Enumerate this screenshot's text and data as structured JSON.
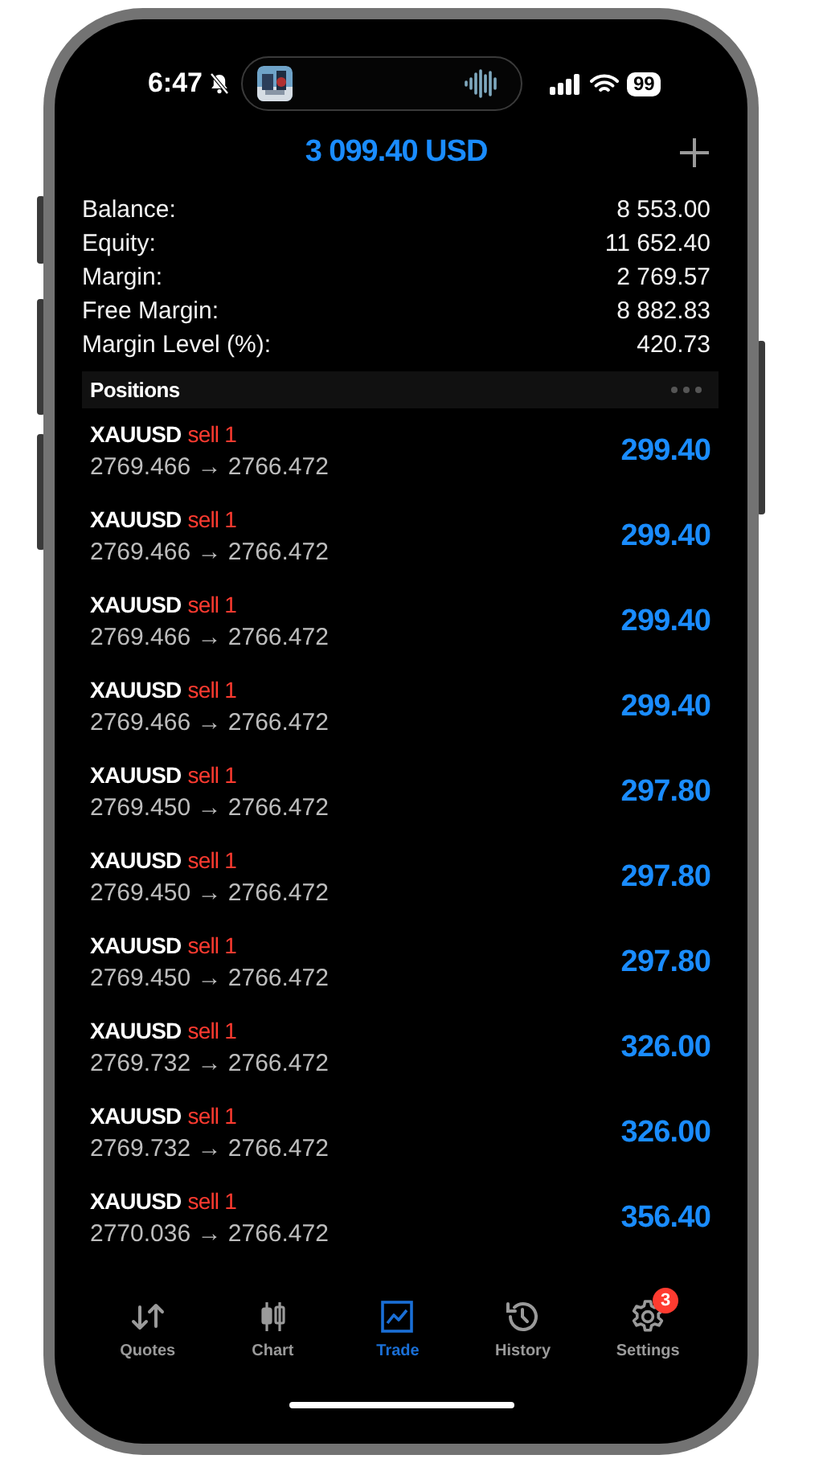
{
  "status_bar": {
    "time": "6:47",
    "battery": "99"
  },
  "header": {
    "title": "3 099.40 USD"
  },
  "summary": [
    {
      "label": "Balance:",
      "value": "8 553.00"
    },
    {
      "label": "Equity:",
      "value": "11 652.40"
    },
    {
      "label": "Margin:",
      "value": "2 769.57"
    },
    {
      "label": "Free Margin:",
      "value": "8 882.83"
    },
    {
      "label": "Margin Level (%):",
      "value": "420.73"
    }
  ],
  "positions": {
    "title": "Positions",
    "rows": [
      {
        "symbol": "XAUUSD",
        "side": "sell 1",
        "prices": "2769.466 → 2766.472",
        "profit": "299.40"
      },
      {
        "symbol": "XAUUSD",
        "side": "sell 1",
        "prices": "2769.466 → 2766.472",
        "profit": "299.40"
      },
      {
        "symbol": "XAUUSD",
        "side": "sell 1",
        "prices": "2769.466 → 2766.472",
        "profit": "299.40"
      },
      {
        "symbol": "XAUUSD",
        "side": "sell 1",
        "prices": "2769.466 → 2766.472",
        "profit": "299.40"
      },
      {
        "symbol": "XAUUSD",
        "side": "sell 1",
        "prices": "2769.450 → 2766.472",
        "profit": "297.80"
      },
      {
        "symbol": "XAUUSD",
        "side": "sell 1",
        "prices": "2769.450 → 2766.472",
        "profit": "297.80"
      },
      {
        "symbol": "XAUUSD",
        "side": "sell 1",
        "prices": "2769.450 → 2766.472",
        "profit": "297.80"
      },
      {
        "symbol": "XAUUSD",
        "side": "sell 1",
        "prices": "2769.732 → 2766.472",
        "profit": "326.00"
      },
      {
        "symbol": "XAUUSD",
        "side": "sell 1",
        "prices": "2769.732 → 2766.472",
        "profit": "326.00"
      },
      {
        "symbol": "XAUUSD",
        "side": "sell 1",
        "prices": "2770.036 → 2766.472",
        "profit": "356.40"
      }
    ]
  },
  "tabs": [
    {
      "label": "Quotes",
      "selected": false
    },
    {
      "label": "Chart",
      "selected": false
    },
    {
      "label": "Trade",
      "selected": true
    },
    {
      "label": "History",
      "selected": false
    },
    {
      "label": "Settings",
      "selected": false,
      "badge": "3"
    }
  ]
}
